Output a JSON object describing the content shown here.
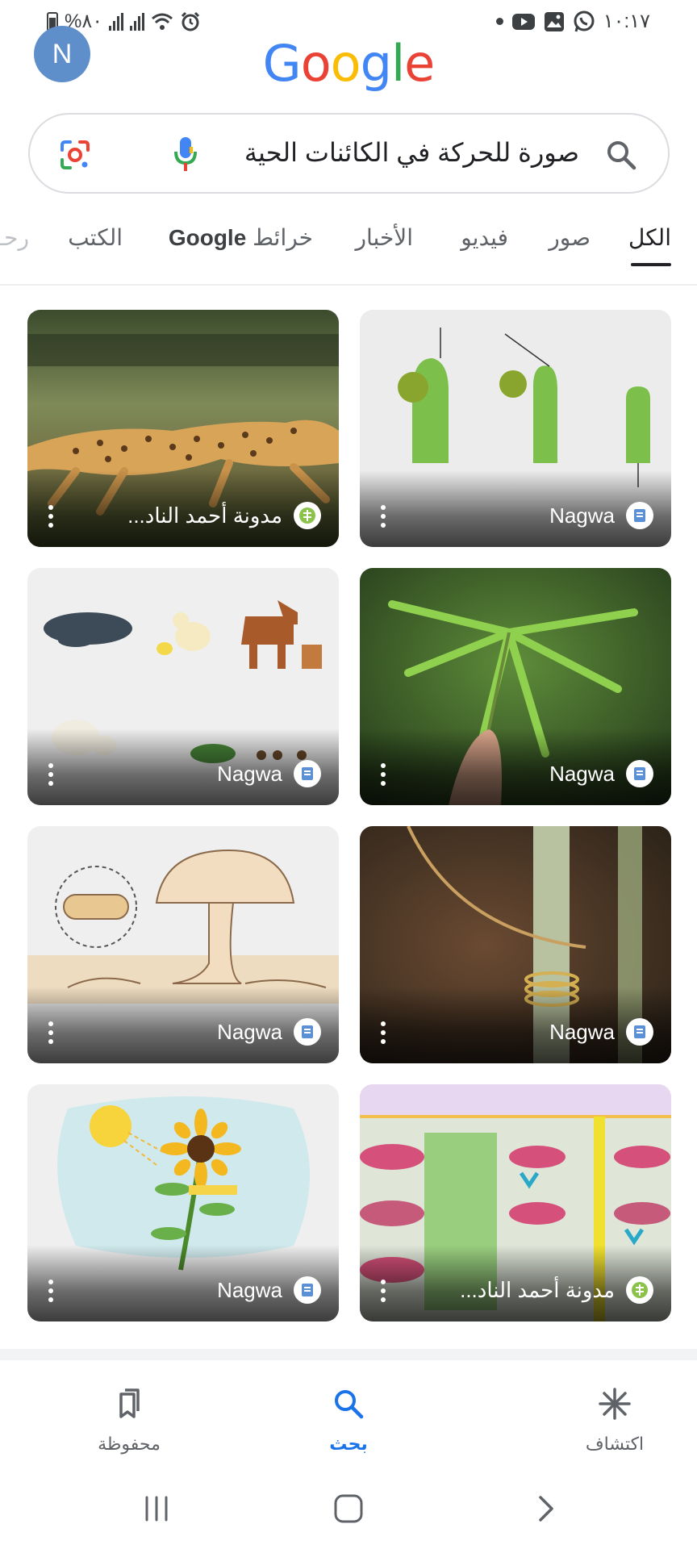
{
  "status_bar": {
    "battery_text": "%٨٠",
    "time": "١٠:١٧",
    "icons": [
      "battery-icon",
      "signal-icon",
      "signal-icon",
      "wifi-icon",
      "alarm-icon",
      "dot-icon",
      "youtube-icon",
      "gallery-icon",
      "whatsapp-icon"
    ]
  },
  "header": {
    "avatar_letter": "N",
    "logo_letters": [
      "G",
      "o",
      "o",
      "g",
      "l",
      "e"
    ]
  },
  "search": {
    "query": "صورة للحركة في الكائنات الحية"
  },
  "tabs": [
    {
      "label": "الكل",
      "active": true
    },
    {
      "label": "صور",
      "active": false
    },
    {
      "label": "فيديو",
      "active": false
    },
    {
      "label": "الأخبار",
      "active": false
    },
    {
      "label": "خرائط",
      "active": false
    },
    {
      "label": "Google",
      "active": false
    },
    {
      "label": "الكتب",
      "active": false
    },
    {
      "label": "رحـ",
      "active": false
    }
  ],
  "results": [
    {
      "site": "Nagwa",
      "favicon": "nagwa-favicon",
      "image": "plant-tendril-diagram"
    },
    {
      "site": "مدونة أحمد الناد...",
      "favicon": "blog-favicon",
      "image": "running-cheetah"
    },
    {
      "site": "Nagwa",
      "favicon": "nagwa-favicon",
      "image": "mimosa-leaf"
    },
    {
      "site": "Nagwa",
      "favicon": "nagwa-favicon",
      "image": "animals-reproduction"
    },
    {
      "site": "Nagwa",
      "favicon": "nagwa-favicon",
      "image": "tendril-coil"
    },
    {
      "site": "Nagwa",
      "favicon": "nagwa-favicon",
      "image": "fungus-diagram"
    },
    {
      "site": "مدونة أحمد الناد...",
      "favicon": "blog-favicon",
      "image": "asexual-reproduction-lesson"
    },
    {
      "site": "Nagwa",
      "favicon": "nagwa-favicon",
      "image": "sunflower-phototropism"
    }
  ],
  "bottom_nav": [
    {
      "label": "اكتشاف",
      "icon": "discover-icon",
      "active": false
    },
    {
      "label": "بحث",
      "icon": "search-icon",
      "active": true
    },
    {
      "label": "محفوظة",
      "icon": "saved-icon",
      "active": false
    }
  ],
  "colors": {
    "accent": "#1a73e8",
    "google_blue": "#4285F4",
    "google_red": "#EA4335",
    "google_yellow": "#FBBC05",
    "google_green": "#34A853"
  }
}
